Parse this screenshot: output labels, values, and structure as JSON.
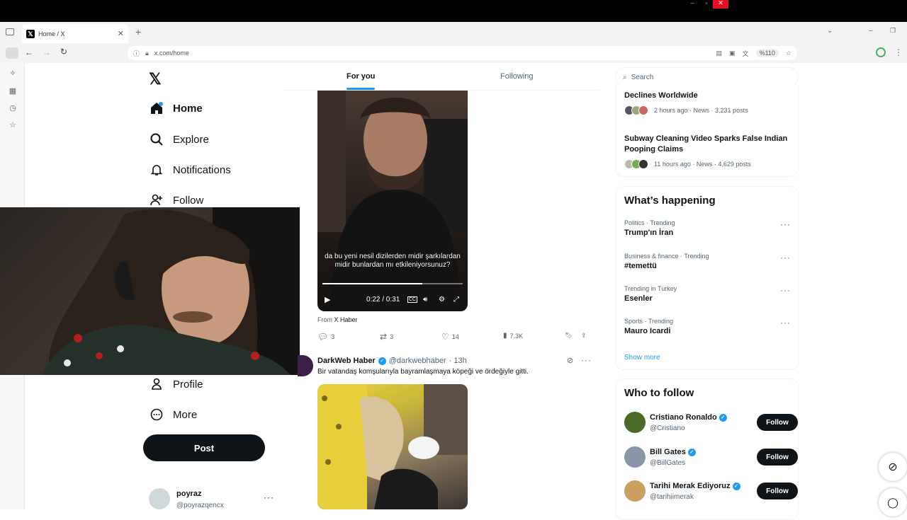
{
  "browser": {
    "tab_title": "Home / X",
    "tab_icon": "x-logo-icon",
    "url": "x.com/home",
    "zoom": "%110"
  },
  "nav": {
    "items": [
      {
        "label": "Home",
        "icon": "home-icon"
      },
      {
        "label": "Explore",
        "icon": "search-icon"
      },
      {
        "label": "Notifications",
        "icon": "bell-icon"
      },
      {
        "label": "Follow",
        "icon": "add-user-icon"
      },
      {
        "label": "Profile",
        "icon": "person-icon"
      },
      {
        "label": "More",
        "icon": "more-circle-icon"
      }
    ],
    "post_label": "Post",
    "account": {
      "name": "poyraz",
      "handle": "@poyrazqencx"
    }
  },
  "feed": {
    "tabs": [
      "For you",
      "Following"
    ],
    "video": {
      "subtitle": "da bu yeni nesil dizilerden midir şarkılardan midir bunlardan mı etkileniyorsunuz?",
      "time": "0:22 / 0:31",
      "progress": 0.71
    },
    "source_prefix": "From",
    "source_name": "X Haber",
    "actions": {
      "replies": "3",
      "reposts": "3",
      "likes": "14",
      "views": "7.3K"
    },
    "tweet2": {
      "author": "DarkWeb Haber",
      "handle": "@darkwebhaber",
      "time": "· 13h",
      "text": "Bir vatandaş komşularıyla bayramlaşmaya köpeği ve ördeğiyle gitti."
    }
  },
  "sidebar": {
    "search_placeholder": "Search",
    "news": [
      {
        "title": "Declines Worldwide",
        "meta": "2 hours ago · News · 3,231 posts"
      },
      {
        "title": "Subway Cleaning Video Sparks False Indian Pooping Claims",
        "meta": "11 hours ago · News · 4,629 posts"
      }
    ],
    "happening_title": "What’s happening",
    "trends": [
      {
        "category": "Politics · Trending",
        "name": "Trump'ın İran"
      },
      {
        "category": "Business & finance · Trending",
        "name": "#temettü"
      },
      {
        "category": "Trending in Turkey",
        "name": "Esenler"
      },
      {
        "category": "Sports · Trending",
        "name": "Mauro Icardi"
      }
    ],
    "show_more": "Show more",
    "who_title": "Who to follow",
    "follow_label": "Follow",
    "who": [
      {
        "name": "Cristiano Ronaldo",
        "handle": "@Cristiano"
      },
      {
        "name": "Bill Gates",
        "handle": "@BillGates"
      },
      {
        "name": "Tarihi Merak Ediyoruz",
        "handle": "@tarihiimerak"
      }
    ]
  },
  "colors": {
    "accent": "#1d9bf0",
    "text": "#0f1419",
    "muted": "#536471"
  }
}
